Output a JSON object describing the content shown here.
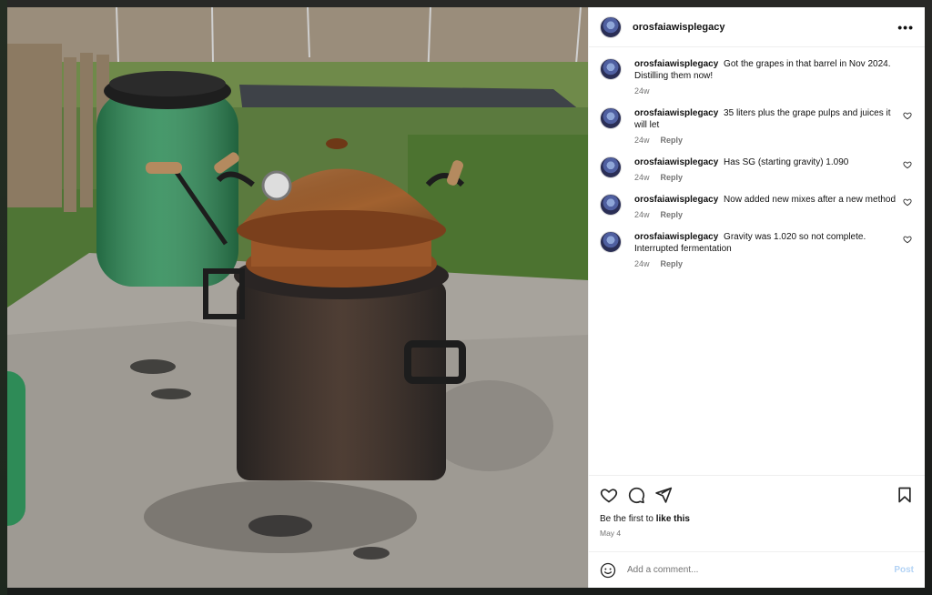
{
  "post": {
    "username": "orosfaiawisplegacy",
    "more_label": "•••"
  },
  "comments": [
    {
      "user": "orosfaiawisplegacy",
      "text": "Got the grapes in that barrel in Nov 2024. Distilling them now!",
      "time": "24w",
      "reply": ""
    },
    {
      "user": "orosfaiawisplegacy",
      "text": "35 liters plus the grape pulps and juices it will let",
      "time": "24w",
      "reply": "Reply"
    },
    {
      "user": "orosfaiawisplegacy",
      "text": "Has SG (starting gravity) 1.090",
      "time": "24w",
      "reply": "Reply"
    },
    {
      "user": "orosfaiawisplegacy",
      "text": "Now added new mixes after a new method",
      "time": "24w",
      "reply": "Reply"
    },
    {
      "user": "orosfaiawisplegacy",
      "text": "Gravity was 1.020 so not complete. Interrupted fermentation",
      "time": "24w",
      "reply": "Reply"
    }
  ],
  "footer": {
    "likes_prefix": "Be the first to",
    "likes_link": "like this",
    "date": "May 4",
    "comment_placeholder": "Add a comment...",
    "post_label": "Post"
  },
  "icons": {
    "like": "heart-icon",
    "comment": "comment-icon",
    "share": "share-icon",
    "save": "bookmark-icon",
    "emoji": "emoji-icon",
    "more": "more-icon"
  },
  "colors": {
    "post_button": "#b3d3f5",
    "muted_text": "#737373"
  }
}
